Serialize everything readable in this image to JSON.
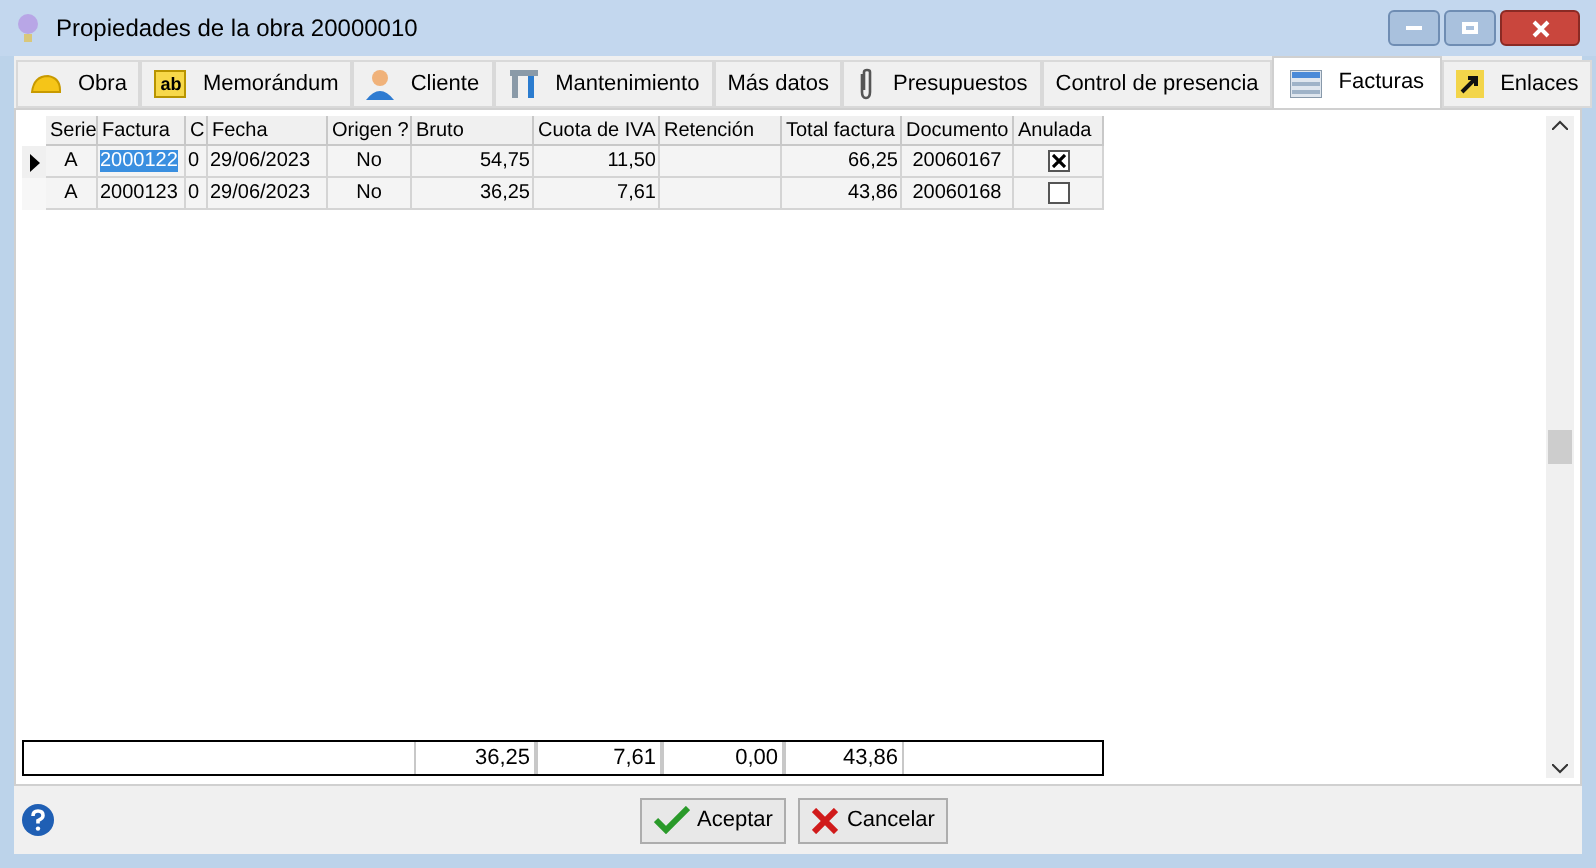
{
  "window": {
    "title": "Propiedades de la obra 20000010"
  },
  "tabs": [
    {
      "label": "Obra",
      "selected": false
    },
    {
      "label": "Memorándum",
      "icon_text": "ab",
      "selected": false
    },
    {
      "label": "Cliente",
      "selected": false
    },
    {
      "label": "Mantenimiento",
      "selected": false
    },
    {
      "label": "Más datos",
      "selected": false
    },
    {
      "label": "Presupuestos",
      "selected": false
    },
    {
      "label": "Control de presencia",
      "selected": false
    },
    {
      "label": "Facturas",
      "selected": true
    },
    {
      "label": "Enlaces",
      "selected": false
    }
  ],
  "table": {
    "columns": [
      "Serie",
      "Factura",
      "C",
      "Fecha",
      "Origen ?",
      "Bruto",
      "Cuota de IVA",
      "Retención",
      "Total factura",
      "Documento",
      "Anulada"
    ],
    "rows": [
      {
        "current": true,
        "cells": [
          "A",
          "2000122",
          "0",
          "29/06/2023",
          "No",
          "54,75",
          "11,50",
          "",
          "66,25",
          "20060167"
        ],
        "anulada": true
      },
      {
        "current": false,
        "cells": [
          "A",
          "2000123",
          "0",
          "29/06/2023",
          "No",
          "36,25",
          "7,61",
          "",
          "43,86",
          "20060168"
        ],
        "anulada": false
      }
    ],
    "totals": [
      "36,25",
      "7,61",
      "0,00",
      "43,86"
    ]
  },
  "buttons": [
    {
      "label": "Aceptar",
      "kind": "ok"
    },
    {
      "label": "Cancelar",
      "kind": "cancel"
    }
  ]
}
